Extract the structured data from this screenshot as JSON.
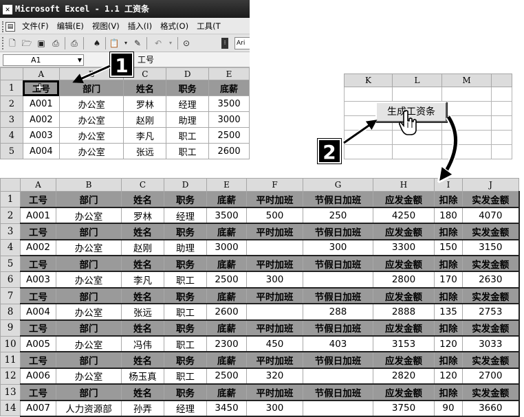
{
  "window": {
    "title": "Microsoft Excel - 1.1 工资条",
    "app_icon": "excel-icon"
  },
  "menu": [
    "文件(F)",
    "编辑(E)",
    "视图(V)",
    "插入(I)",
    "格式(O)",
    "工具(T"
  ],
  "toolbar": {
    "icons": [
      "new-icon",
      "open-icon",
      "save-icon",
      "permission-icon",
      "print-icon",
      "research-icon",
      "paste-icon",
      "format-painter-icon",
      "undo-icon",
      "help-icon"
    ],
    "font_box": "Ari"
  },
  "formula_bar": {
    "cell_ref": "A1",
    "value": "工号"
  },
  "source_sheet": {
    "columns": [
      "A",
      "B",
      "C",
      "D",
      "E"
    ],
    "rows": [
      {
        "n": "1",
        "cells": [
          "工号",
          "部门",
          "姓名",
          "职务",
          "底薪"
        ]
      },
      {
        "n": "2",
        "cells": [
          "A001",
          "办公室",
          "罗林",
          "经理",
          "3500"
        ]
      },
      {
        "n": "3",
        "cells": [
          "A002",
          "办公室",
          "赵刚",
          "助理",
          "3000"
        ]
      },
      {
        "n": "4",
        "cells": [
          "A003",
          "办公室",
          "李凡",
          "职工",
          "2500"
        ]
      },
      {
        "n": "5",
        "cells": [
          "A004",
          "办公室",
          "张远",
          "职工",
          "2600"
        ]
      }
    ]
  },
  "button_sheet": {
    "columns": [
      "K",
      "L",
      "M"
    ],
    "button_label": "生成工资条"
  },
  "steps": {
    "one": "1",
    "two": "2"
  },
  "result_sheet": {
    "columns": [
      "A",
      "B",
      "C",
      "D",
      "E",
      "F",
      "G",
      "H",
      "I",
      "J"
    ],
    "rows": [
      {
        "n": "1",
        "header": true,
        "cells": [
          "工号",
          "部门",
          "姓名",
          "职务",
          "底薪",
          "平时加班",
          "节假日加班",
          "应发金额",
          "扣除",
          "实发金额"
        ]
      },
      {
        "n": "2",
        "header": false,
        "cells": [
          "A001",
          "办公室",
          "罗林",
          "经理",
          "3500",
          "500",
          "250",
          "4250",
          "180",
          "4070"
        ]
      },
      {
        "n": "3",
        "header": true,
        "cells": [
          "工号",
          "部门",
          "姓名",
          "职务",
          "底薪",
          "平时加班",
          "节假日加班",
          "应发金额",
          "扣除",
          "实发金额"
        ]
      },
      {
        "n": "4",
        "header": false,
        "cells": [
          "A002",
          "办公室",
          "赵刚",
          "助理",
          "3000",
          "",
          "300",
          "3300",
          "150",
          "3150"
        ]
      },
      {
        "n": "5",
        "header": true,
        "cells": [
          "工号",
          "部门",
          "姓名",
          "职务",
          "底薪",
          "平时加班",
          "节假日加班",
          "应发金额",
          "扣除",
          "实发金额"
        ]
      },
      {
        "n": "6",
        "header": false,
        "cells": [
          "A003",
          "办公室",
          "李凡",
          "职工",
          "2500",
          "300",
          "",
          "2800",
          "170",
          "2630"
        ]
      },
      {
        "n": "7",
        "header": true,
        "cells": [
          "工号",
          "部门",
          "姓名",
          "职务",
          "底薪",
          "平时加班",
          "节假日加班",
          "应发金额",
          "扣除",
          "实发金额"
        ]
      },
      {
        "n": "8",
        "header": false,
        "cells": [
          "A004",
          "办公室",
          "张远",
          "职工",
          "2600",
          "",
          "288",
          "2888",
          "135",
          "2753"
        ]
      },
      {
        "n": "9",
        "header": true,
        "cells": [
          "工号",
          "部门",
          "姓名",
          "职务",
          "底薪",
          "平时加班",
          "节假日加班",
          "应发金额",
          "扣除",
          "实发金额"
        ]
      },
      {
        "n": "10",
        "header": false,
        "cells": [
          "A005",
          "办公室",
          "冯伟",
          "职工",
          "2300",
          "450",
          "403",
          "3153",
          "120",
          "3033"
        ]
      },
      {
        "n": "11",
        "header": true,
        "cells": [
          "工号",
          "部门",
          "姓名",
          "职务",
          "底薪",
          "平时加班",
          "节假日加班",
          "应发金额",
          "扣除",
          "实发金额"
        ]
      },
      {
        "n": "12",
        "header": false,
        "cells": [
          "A006",
          "办公室",
          "杨玉真",
          "职工",
          "2500",
          "320",
          "",
          "2820",
          "120",
          "2700"
        ]
      },
      {
        "n": "13",
        "header": true,
        "cells": [
          "工号",
          "部门",
          "姓名",
          "职务",
          "底薪",
          "平时加班",
          "节假日加班",
          "应发金额",
          "扣除",
          "实发金额"
        ]
      },
      {
        "n": "14",
        "header": false,
        "cells": [
          "A007",
          "人力资源部",
          "孙弄",
          "经理",
          "3450",
          "300",
          "",
          "3750",
          "90",
          "3660"
        ]
      }
    ]
  }
}
